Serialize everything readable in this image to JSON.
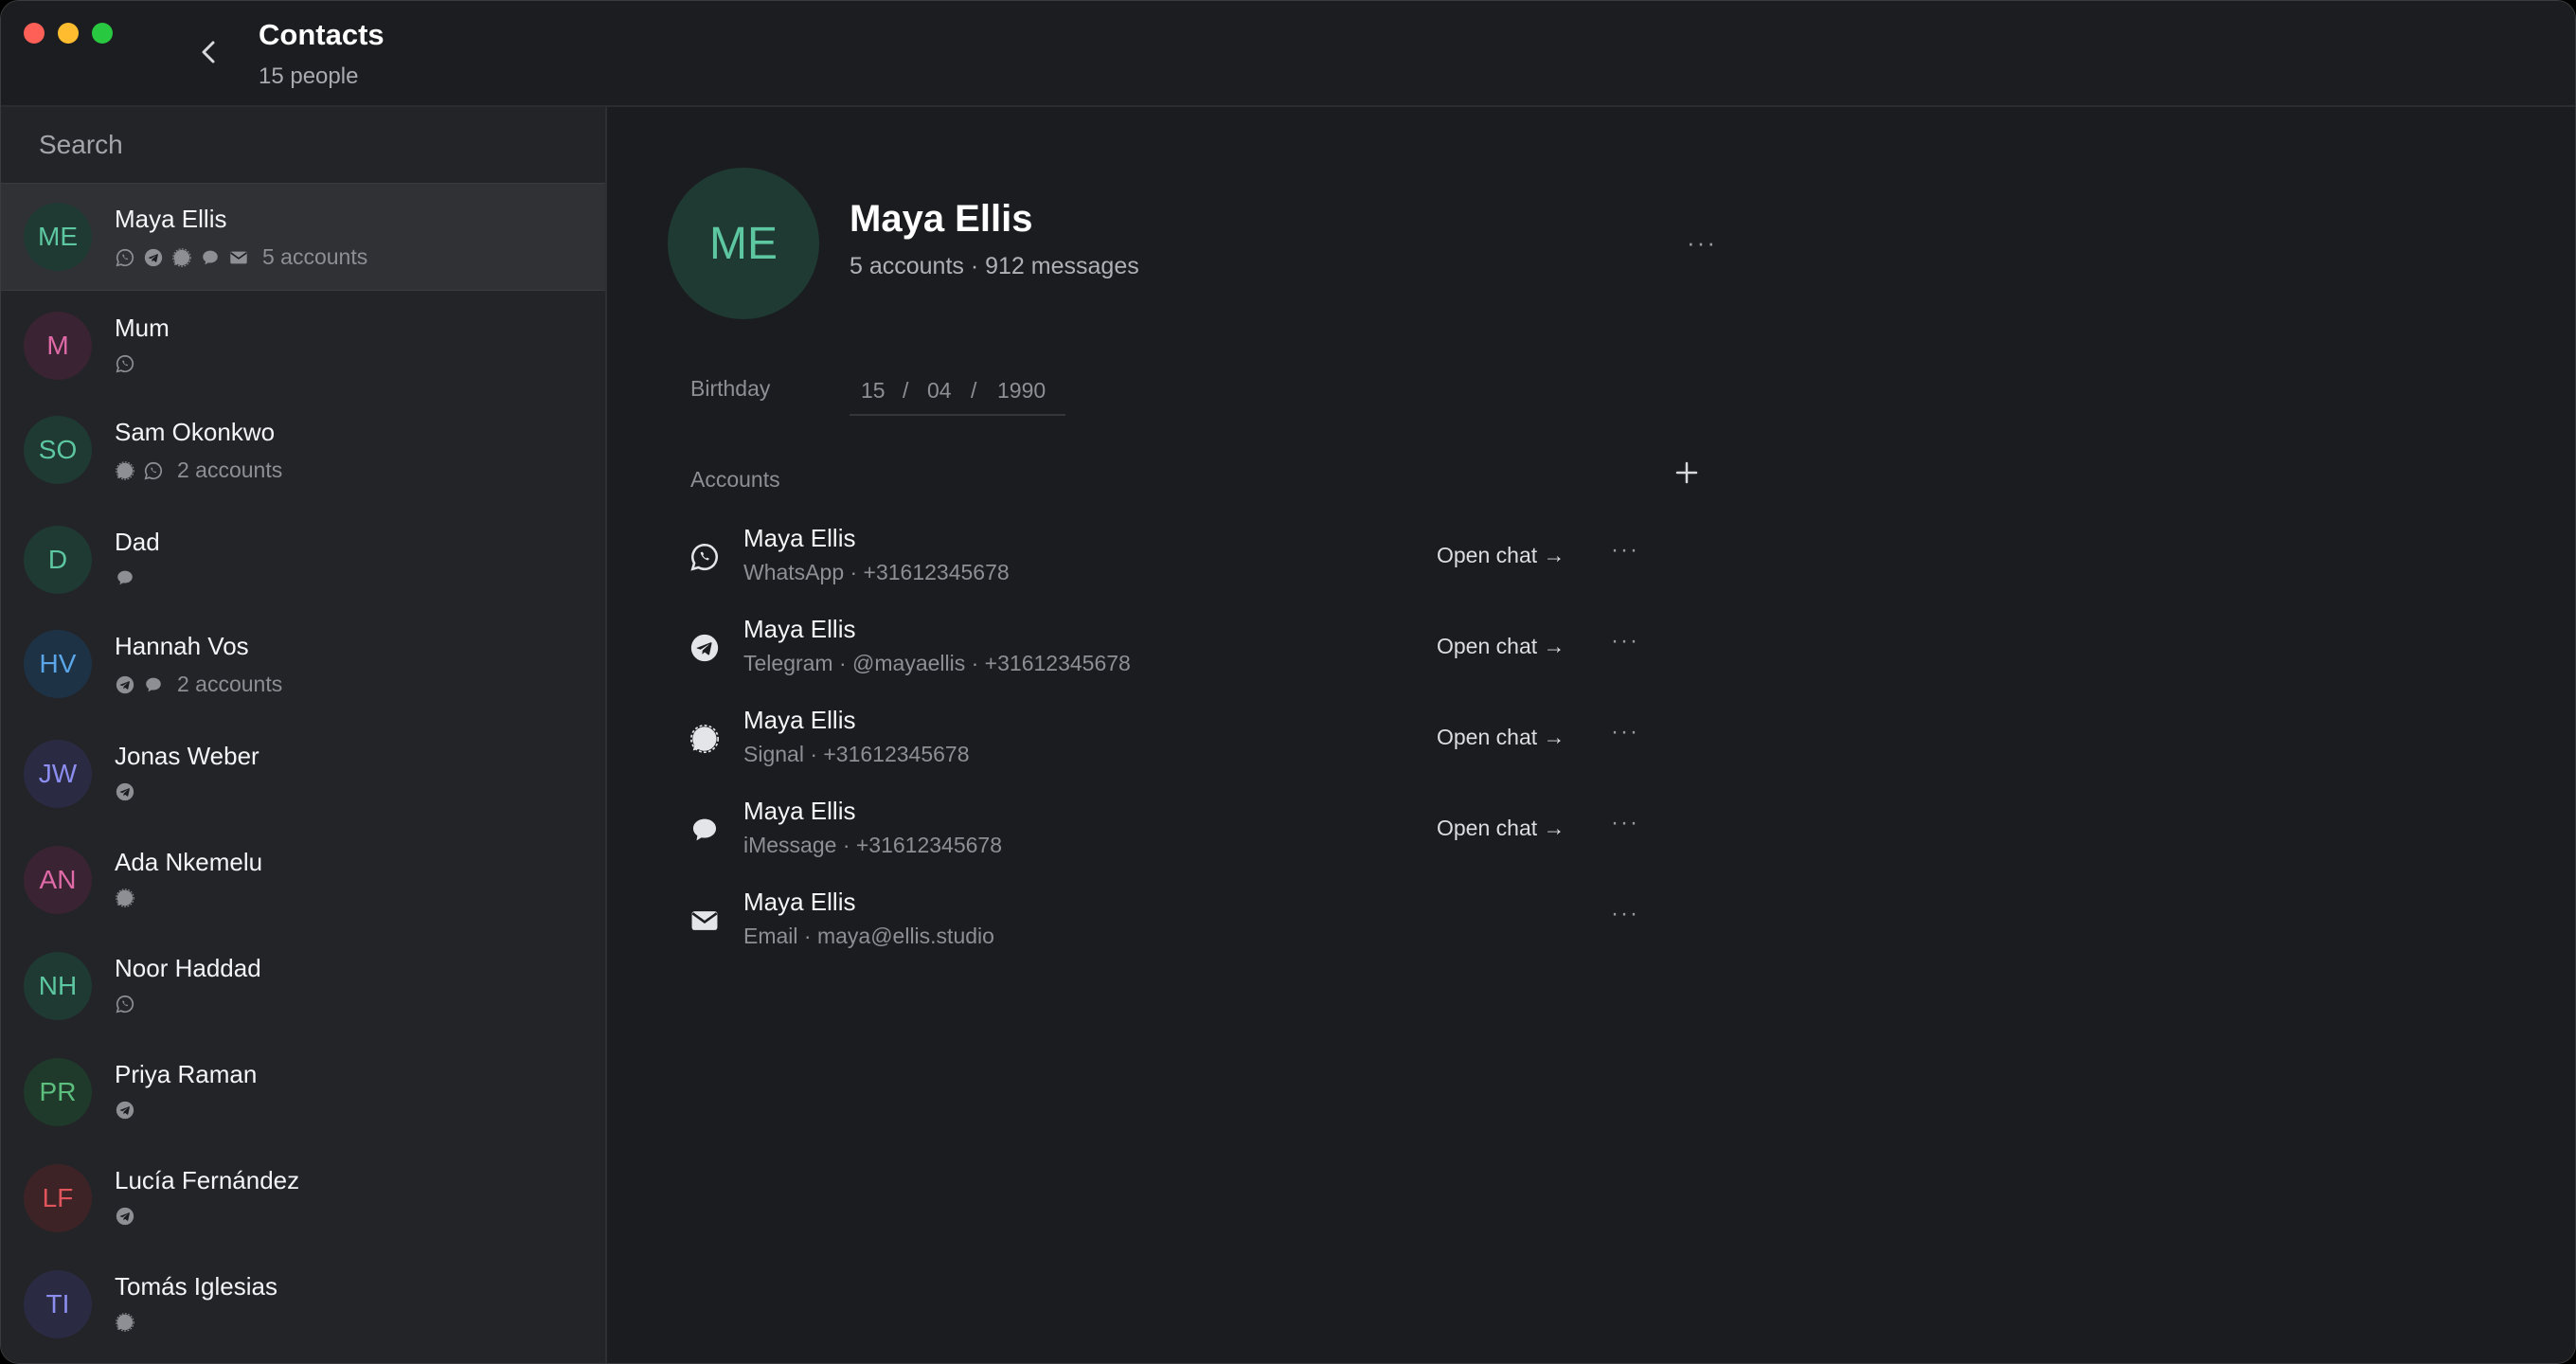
{
  "header": {
    "title": "Contacts",
    "subtitle": "15 people"
  },
  "sidebar": {
    "search_placeholder": "Search",
    "contacts": [
      {
        "initials": "ME",
        "name": "Maya Ellis",
        "icons": [
          "whatsapp-icon",
          "telegram-icon",
          "signal-icon",
          "imessage-icon",
          "email-icon"
        ],
        "count": "5 accounts",
        "avatar_bg": "#1f3a33",
        "avatar_fg": "#5cc7a0",
        "selected": true
      },
      {
        "initials": "M",
        "name": "Mum",
        "icons": [
          "whatsapp-icon"
        ],
        "count": "",
        "avatar_bg": "#3a2332",
        "avatar_fg": "#e06aa8"
      },
      {
        "initials": "SO",
        "name": "Sam Okonkwo",
        "icons": [
          "signal-icon",
          "whatsapp-icon"
        ],
        "count": "2 accounts",
        "avatar_bg": "#1f3a33",
        "avatar_fg": "#5cc7a0"
      },
      {
        "initials": "D",
        "name": "Dad",
        "icons": [
          "imessage-icon"
        ],
        "count": "",
        "avatar_bg": "#1f3a33",
        "avatar_fg": "#5cc7a0"
      },
      {
        "initials": "HV",
        "name": "Hannah Vos",
        "icons": [
          "telegram-icon",
          "imessage-icon"
        ],
        "count": "2 accounts",
        "avatar_bg": "#1e3246",
        "avatar_fg": "#5aa6e8"
      },
      {
        "initials": "JW",
        "name": "Jonas Weber",
        "icons": [
          "telegram-icon"
        ],
        "count": "",
        "avatar_bg": "#2a2b42",
        "avatar_fg": "#8b8ef0"
      },
      {
        "initials": "AN",
        "name": "Ada Nkemelu",
        "icons": [
          "signal-icon"
        ],
        "count": "",
        "avatar_bg": "#3a2332",
        "avatar_fg": "#e06aa8"
      },
      {
        "initials": "NH",
        "name": "Noor Haddad",
        "icons": [
          "whatsapp-icon"
        ],
        "count": "",
        "avatar_bg": "#1f3a33",
        "avatar_fg": "#5cc7a0"
      },
      {
        "initials": "PR",
        "name": "Priya Raman",
        "icons": [
          "telegram-icon"
        ],
        "count": "",
        "avatar_bg": "#1f3a2a",
        "avatar_fg": "#5cbf7e"
      },
      {
        "initials": "LF",
        "name": "Lucía Fernández",
        "icons": [
          "telegram-icon"
        ],
        "count": "",
        "avatar_bg": "#3e2326",
        "avatar_fg": "#e0545c"
      },
      {
        "initials": "TI",
        "name": "Tomás Iglesias",
        "icons": [
          "signal-icon"
        ],
        "count": "",
        "avatar_bg": "#2a2b42",
        "avatar_fg": "#8b8ef0"
      }
    ]
  },
  "profile": {
    "initials": "ME",
    "name": "Maya Ellis",
    "stats": "5 accounts · 912 messages",
    "more": "···",
    "birthday_label": "Birthday",
    "birthday": {
      "day": "15",
      "month": "04",
      "year": "1990",
      "sep": "/"
    },
    "accounts_label": "Accounts",
    "open_chat_label": "Open chat →",
    "accounts": [
      {
        "icon": "whatsapp-icon",
        "name": "Maya Ellis",
        "detail": "WhatsApp · +31612345678",
        "open_chat": true
      },
      {
        "icon": "telegram-icon",
        "name": "Maya Ellis",
        "detail": "Telegram · @mayaellis · +31612345678",
        "open_chat": true
      },
      {
        "icon": "signal-icon",
        "name": "Maya Ellis",
        "detail": "Signal · +31612345678",
        "open_chat": true
      },
      {
        "icon": "imessage-icon",
        "name": "Maya Ellis",
        "detail": "iMessage · +31612345678",
        "open_chat": true
      },
      {
        "icon": "email-icon",
        "name": "Maya Ellis",
        "detail": "Email · maya@ellis.studio",
        "open_chat": false
      }
    ]
  },
  "colors": {
    "accent_green": "#5cc7a0",
    "window_bg": "#1b1c1f",
    "sidebar_bg": "#232428"
  }
}
